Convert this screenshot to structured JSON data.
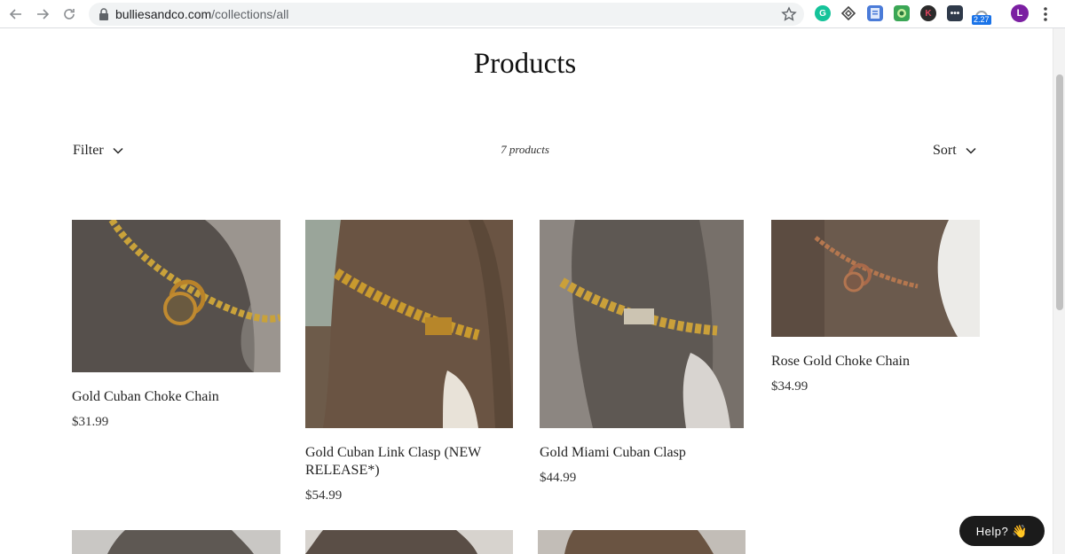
{
  "browser": {
    "url_domain": "bulliesandco.com",
    "url_path": "/collections/all",
    "extension_badge": "2.27",
    "profile_initial": "L",
    "extension_k_letter": "K"
  },
  "page": {
    "title": "Products",
    "filter_label": "Filter",
    "sort_label": "Sort",
    "product_count": "7 products"
  },
  "products": [
    {
      "name": "Gold Cuban Choke Chain",
      "price": "$31.99",
      "chain_color": "#c9a23a"
    },
    {
      "name": "Gold Cuban Link Clasp (NEW RELEASE*)",
      "price": "$54.99",
      "chain_color": "#c99a2e"
    },
    {
      "name": "Gold Miami Cuban Clasp",
      "price": "$44.99",
      "chain_color": "#caa03a"
    },
    {
      "name": "Rose Gold Choke Chain",
      "price": "$34.99",
      "chain_color": "#b5774f"
    }
  ],
  "help": {
    "label": "Help?",
    "icon": "waving-hand-icon"
  },
  "colors": {
    "help_bg": "#1b1b1b",
    "dog_fur": "#5a5450",
    "accent_profile": "#7b1fa2"
  }
}
